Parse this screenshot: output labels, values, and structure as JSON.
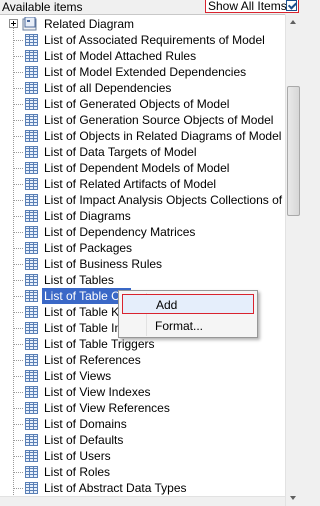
{
  "header": {
    "title": "Available items",
    "show_all_label": "Show All Items",
    "show_all_checked": true
  },
  "tree": {
    "root_label": "Related Diagram",
    "items": [
      "List of Associated Requirements of Model",
      "List of Model Attached Rules",
      "List of Model Extended Dependencies",
      "List of all Dependencies",
      "List of Generated Objects of Model",
      "List of Generation Source Objects of Model",
      "List of Objects in Related Diagrams of Model",
      "List of Data Targets of Model",
      "List of Dependent Models of Model",
      "List of Related Artifacts of Model",
      "List of Impact Analysis Objects Collections of Model",
      "List of Diagrams",
      "List of Dependency Matrices",
      "List of Packages",
      "List of Business Rules",
      "List of Tables",
      "List of Table Col",
      "List of Table Key",
      "List of Table Ind",
      "List of Table Triggers",
      "List of References",
      "List of Views",
      "List of View Indexes",
      "List of View References",
      "List of Domains",
      "List of Defaults",
      "List of Users",
      "List of Roles",
      "List of Abstract Data Types"
    ],
    "selected_index": 16
  },
  "context_menu": {
    "items": [
      "Add",
      "Format..."
    ]
  },
  "colors": {
    "selection": "#3a68c7",
    "highlight_border": "#d9232e"
  }
}
